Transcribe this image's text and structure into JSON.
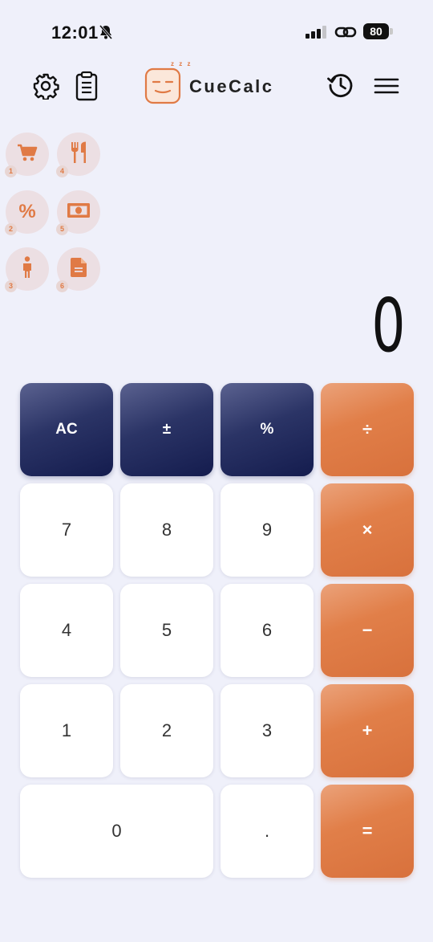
{
  "status_bar": {
    "time": "12:01",
    "battery": "80"
  },
  "header": {
    "app_title": "CueCalc",
    "logo_sleep": "z z z",
    "icons": [
      "gear-icon",
      "clipboard-icon",
      "history-icon",
      "hamburger-menu-icon"
    ]
  },
  "shortcuts": [
    {
      "num": "1",
      "icon": "cart-icon"
    },
    {
      "num": "2",
      "icon": "percent-icon",
      "text": "%"
    },
    {
      "num": "3",
      "icon": "person-icon"
    },
    {
      "num": "4",
      "icon": "fork-knife-icon"
    },
    {
      "num": "5",
      "icon": "banknote-icon"
    },
    {
      "num": "6",
      "icon": "document-icon"
    }
  ],
  "display": {
    "value": "0"
  },
  "keypad": {
    "ac": "AC",
    "plus_minus": "±",
    "percent": "%",
    "divide": "÷",
    "seven": "7",
    "eight": "8",
    "nine": "9",
    "multiply": "×",
    "four": "4",
    "five": "5",
    "six": "6",
    "minus": "−",
    "one": "1",
    "two": "2",
    "three": "3",
    "plus": "+",
    "zero": "0",
    "decimal": ".",
    "equals": "="
  },
  "colors": {
    "accent": "#e07a45",
    "function_key": "#2b3466",
    "background": "#eff0fa"
  }
}
